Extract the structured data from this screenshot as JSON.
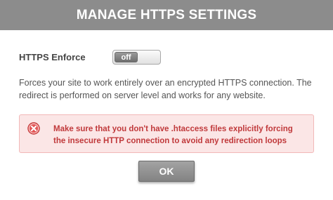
{
  "dialog": {
    "title": "MANAGE HTTPS SETTINGS"
  },
  "setting": {
    "label": "HTTPS Enforce",
    "toggle_state": "off",
    "description": "Forces your site to work entirely over an encrypted HTTPS connection. The redirect is performed on server level and works for any website."
  },
  "alert": {
    "icon": "error-x-icon",
    "message": "Make sure that you don't have .htaccess files explicitly forcing the insecure HTTP connection to avoid any redirection loops",
    "text_color": "#c0393b",
    "background_color": "#fbe6e6"
  },
  "buttons": {
    "ok_label": "OK"
  }
}
